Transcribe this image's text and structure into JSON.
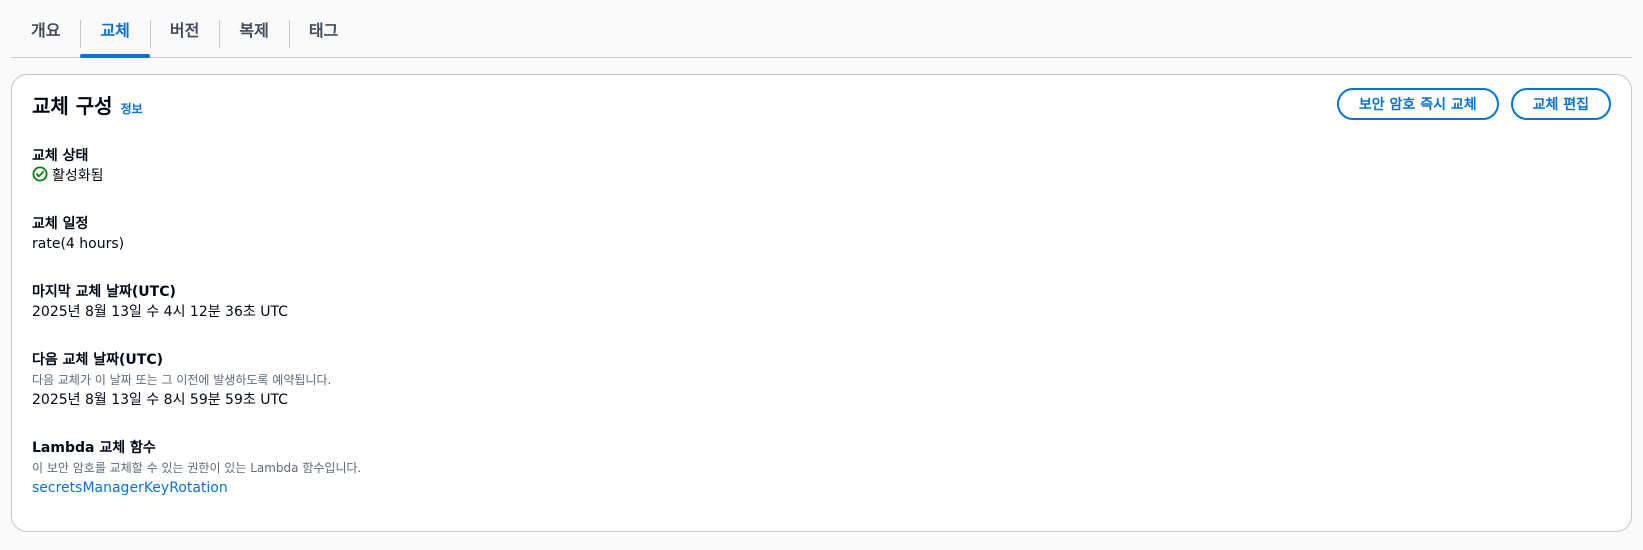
{
  "tabs": [
    {
      "label": "개요"
    },
    {
      "label": "교체",
      "active": true
    },
    {
      "label": "버전"
    },
    {
      "label": "복제"
    },
    {
      "label": "태그"
    }
  ],
  "panel": {
    "title": "교체 구성",
    "info_link": "정보",
    "actions": {
      "rotate_now": "보안 암호 즉시 교체",
      "edit_rotation": "교체 편집"
    }
  },
  "fields": {
    "status": {
      "label": "교체 상태",
      "value": "활성화됨",
      "icon": "check-circle-icon",
      "color": "#037f0c"
    },
    "schedule": {
      "label": "교체 일정",
      "value": "rate(4 hours)"
    },
    "last_rotated": {
      "label": "마지막 교체 날짜(UTC)",
      "value": "2025년 8월 13일 수 4시 12분 36초 UTC"
    },
    "next_rotation": {
      "label": "다음 교체 날짜(UTC)",
      "description": "다음 교체가 이 날짜 또는 그 이전에 발생하도록 예약됩니다.",
      "value": "2025년 8월 13일 수 8시 59분 59초 UTC"
    },
    "lambda": {
      "label": "Lambda 교체 함수",
      "description": "이 보안 암호를 교체할 수 있는 권한이 있는 Lambda 함수입니다.",
      "value": "secretsManagerKeyRotation"
    }
  },
  "colors": {
    "accent": "#0972d3",
    "success": "#037f0c"
  }
}
